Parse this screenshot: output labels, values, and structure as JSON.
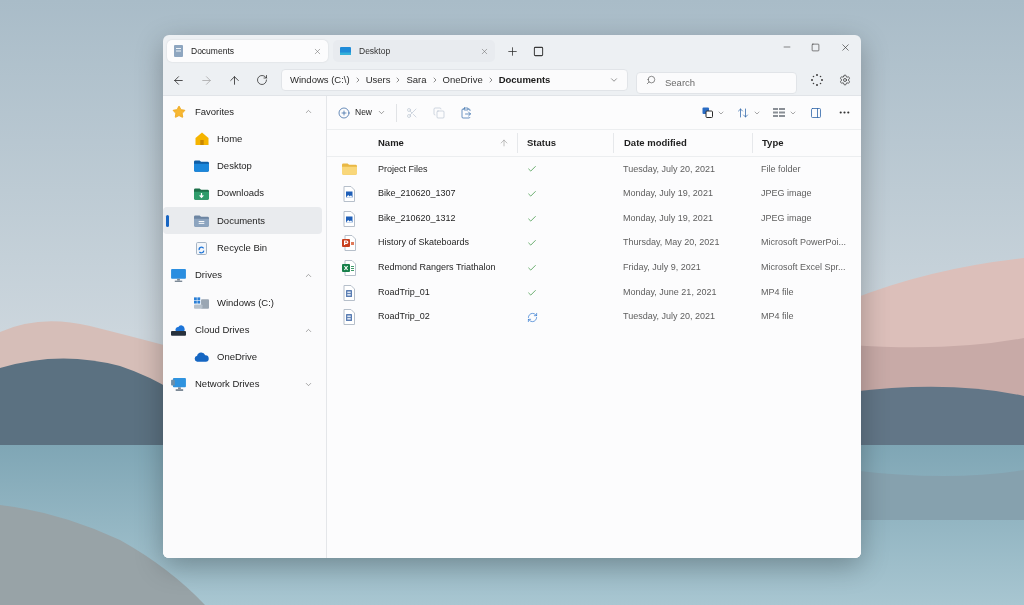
{
  "tabs": [
    {
      "label": "Documents",
      "kind": "documents",
      "selected": true
    },
    {
      "label": "Desktop",
      "kind": "desktop",
      "selected": false
    }
  ],
  "address_bar": {
    "segments": [
      "Windows (C:\\)",
      "Users",
      "Sara",
      "OneDrive",
      "Documents"
    ]
  },
  "search": {
    "placeholder": "Search"
  },
  "sidebar": {
    "groups": [
      {
        "label": "Favorites",
        "kind": "favorites",
        "expanded": true,
        "selected": false,
        "children": [
          {
            "label": "Home",
            "kind": "home",
            "selected": false
          },
          {
            "label": "Desktop",
            "kind": "desktop",
            "selected": false
          },
          {
            "label": "Downloads",
            "kind": "downloads",
            "selected": false
          },
          {
            "label": "Documents",
            "kind": "documents",
            "selected": true
          },
          {
            "label": "Recycle Bin",
            "kind": "recycle",
            "selected": false
          }
        ]
      },
      {
        "label": "Drives",
        "kind": "drives",
        "expanded": true,
        "selected": false,
        "children": [
          {
            "label": "Windows (C:)",
            "kind": "disk",
            "selected": false
          }
        ]
      },
      {
        "label": "Cloud Drives",
        "kind": "cloud_drives",
        "expanded": true,
        "selected": false,
        "children": [
          {
            "label": "OneDrive",
            "kind": "onedrive",
            "selected": false
          }
        ]
      },
      {
        "label": "Network Drives",
        "kind": "network",
        "expanded": false,
        "selected": false
      }
    ]
  },
  "toolbar": {
    "new_label": "New",
    "actions": [
      {
        "kind": "cut",
        "disabled": true
      },
      {
        "kind": "copy",
        "disabled": true
      },
      {
        "kind": "paste",
        "disabled": false
      }
    ]
  },
  "table": {
    "columns": [
      {
        "label": "Name",
        "sorted": true
      },
      {
        "label": "Status",
        "sorted": false
      },
      {
        "label": "Date modified",
        "sorted": false
      },
      {
        "label": "Type",
        "sorted": false
      }
    ],
    "rows": [
      {
        "kind": "folder",
        "name": "Project Files",
        "syncing": false,
        "date": "Tuesday, July 20, 2021",
        "type": "File folder"
      },
      {
        "kind": "image",
        "name": "Bike_210620_1307",
        "syncing": false,
        "date": "Monday, July 19, 2021",
        "type": "JPEG image"
      },
      {
        "kind": "image",
        "name": "Bike_210620_1312",
        "syncing": false,
        "date": "Monday, July 19, 2021",
        "type": "JPEG image"
      },
      {
        "kind": "presentation",
        "name": "History of Skateboards",
        "syncing": false,
        "date": "Thursday, May 20, 2021",
        "type": "Microsoft PowerPoi..."
      },
      {
        "kind": "spreadsheet",
        "name": "Redmond Rangers Triathalon",
        "syncing": false,
        "date": "Friday, July 9, 2021",
        "type": "Microsoft Excel Spr..."
      },
      {
        "kind": "video",
        "name": "RoadTrip_01",
        "syncing": false,
        "date": "Monday, June 21, 2021",
        "type": "MP4 file"
      },
      {
        "kind": "video",
        "name": "RoadTrip_02",
        "syncing": true,
        "date": "Tuesday, July 20, 2021",
        "type": "MP4 file"
      }
    ]
  }
}
